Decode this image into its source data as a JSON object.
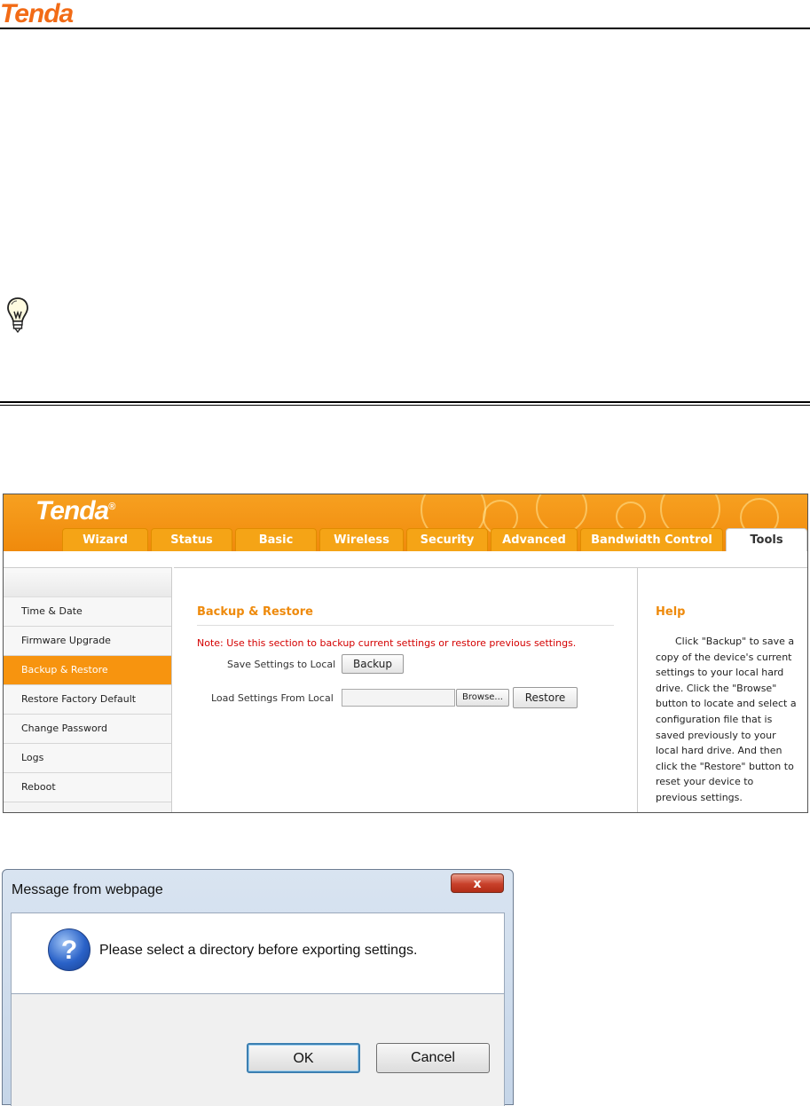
{
  "document": {
    "logo": "Tenda"
  },
  "router": {
    "logo": "Tenda",
    "logo_mark": "®",
    "tabs": [
      {
        "label": "Wizard"
      },
      {
        "label": "Status"
      },
      {
        "label": "Basic"
      },
      {
        "label": "Wireless"
      },
      {
        "label": "Security"
      },
      {
        "label": "Advanced"
      },
      {
        "label": "Bandwidth Control"
      },
      {
        "label": "Tools",
        "active": true
      }
    ],
    "sidebar": [
      {
        "label": "Time & Date"
      },
      {
        "label": "Firmware Upgrade"
      },
      {
        "label": "Backup & Restore",
        "active": true
      },
      {
        "label": "Restore Factory Default"
      },
      {
        "label": "Change Password"
      },
      {
        "label": "Logs"
      },
      {
        "label": "Reboot"
      }
    ],
    "content": {
      "title": "Backup & Restore",
      "note": "Note: Use this section to backup current settings or restore previous settings.",
      "save_label": "Save Settings to Local",
      "backup_button": "Backup",
      "load_label": "Load Settings From Local",
      "file_value": "",
      "browse_button": "Browse...",
      "restore_button": "Restore"
    },
    "help": {
      "title": "Help",
      "text": "Click \"Backup\" to save a copy of the device's current settings to your local hard drive. Click the \"Browse\" button to locate and select a configuration file that is saved previously to your local hard drive. And then click the \"Restore\" button to reset your device to previous settings."
    },
    "colors": {
      "accent": "#f7940f",
      "note": "#d40000"
    }
  },
  "dialog": {
    "title": "Message from webpage",
    "close_glyph": "x",
    "icon": "question-icon",
    "icon_glyph": "?",
    "message": "Please select a directory before exporting settings.",
    "ok_button": "OK",
    "cancel_button": "Cancel"
  }
}
